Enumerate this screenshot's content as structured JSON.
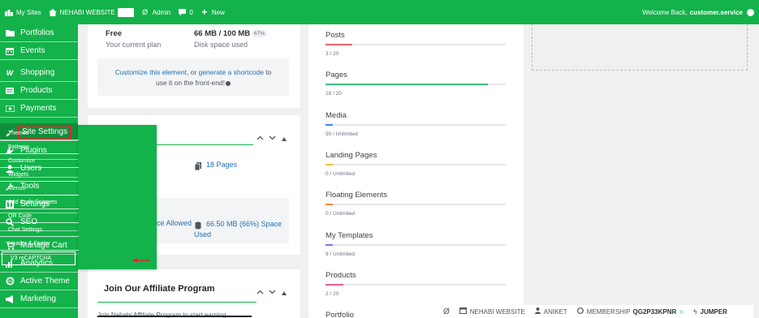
{
  "adminbar": {
    "my_sites": "My Sites",
    "site_name": "NEHABI WEBSITE",
    "admin": "Admin",
    "comments_count": "0",
    "new": "New",
    "welcome": "Welcome Back,",
    "username": "customer.service"
  },
  "sidebar": {
    "items": [
      {
        "label": "Portfolios",
        "icon": "folder-icon"
      },
      {
        "label": "Events",
        "icon": "calendar-icon"
      },
      {
        "label": "Shopping",
        "icon": "woo-icon"
      },
      {
        "label": "Products",
        "icon": "products-icon"
      },
      {
        "label": "Payments",
        "icon": "payments-icon"
      },
      {
        "label": "Site Settings",
        "icon": "brush-icon"
      },
      {
        "label": "Plugins",
        "icon": "plugin-icon"
      },
      {
        "label": "Users",
        "icon": "users-icon"
      },
      {
        "label": "Tools",
        "icon": "tools-icon"
      },
      {
        "label": "Settings",
        "icon": "settings-icon"
      },
      {
        "label": "SEO",
        "icon": "seo-icon"
      },
      {
        "label": "Manage Cart",
        "icon": "cart-icon"
      },
      {
        "label": "Analytics",
        "icon": "analytics-icon"
      },
      {
        "label": "Active Theme",
        "icon": "theme-icon"
      },
      {
        "label": "Marketing",
        "icon": "megaphone-icon"
      }
    ]
  },
  "submenu": {
    "items": [
      "Themes",
      "Patterns",
      "Customize",
      "Widgets",
      "Menus",
      "Add Code Snippets",
      "QR Code",
      "Chat Settings",
      "Header & Footer",
      "V3 reCAPTCHA"
    ]
  },
  "plan": {
    "name": "Free",
    "name_caption": "Your current plan",
    "disk": "66 MB / 100 MB",
    "disk_percent": "67%",
    "disk_caption": "Disk space used",
    "customize_link": "Customize this element",
    "customize_mid": ", or ",
    "shortcode_link": "generate a shortcode",
    "customize_tail1": " to",
    "customize_tail2": "use it on the front-end!"
  },
  "content_card": {
    "pages": "18 Pages",
    "space_allowed": "ce Allowed",
    "space_used": "66.50 MB (66%) Space Used"
  },
  "affiliate": {
    "title": "Join Our Affiliate Program",
    "cut_text": "Join Nehabi Affiliate Program to start earning"
  },
  "usage": [
    {
      "label": "Posts",
      "count": "3 / 20",
      "fraction": 0.15,
      "color": "#e8656b"
    },
    {
      "label": "Pages",
      "count": "18 / 20",
      "fraction": 0.9,
      "color": "#3fbf7a"
    },
    {
      "label": "Media",
      "count": "90 / Unlimited",
      "fraction": 0.04,
      "color": "#3a86ff"
    },
    {
      "label": "Landing Pages",
      "count": "0 / Unlimited",
      "fraction": 0.04,
      "color": "#f4c542"
    },
    {
      "label": "Floating Elements",
      "count": "0 / Unlimited",
      "fraction": 0.04,
      "color": "#f28c38"
    },
    {
      "label": "My Templates",
      "count": "9 / Unlimited",
      "fraction": 0.04,
      "color": "#8e6cf5"
    },
    {
      "label": "Products",
      "count": "2 / 20",
      "fraction": 0.1,
      "color": "#e85a9a"
    },
    {
      "label": "Portfolio",
      "count": "",
      "fraction": 0,
      "color": "#e5e7eb"
    }
  ],
  "footerbar": {
    "site": "NEHABI WEBSITE",
    "user": "ANIKET",
    "membership_label": "MEMBERSHIP",
    "membership_code": "QG2P33KPNR",
    "jumper": "JUMPER"
  }
}
